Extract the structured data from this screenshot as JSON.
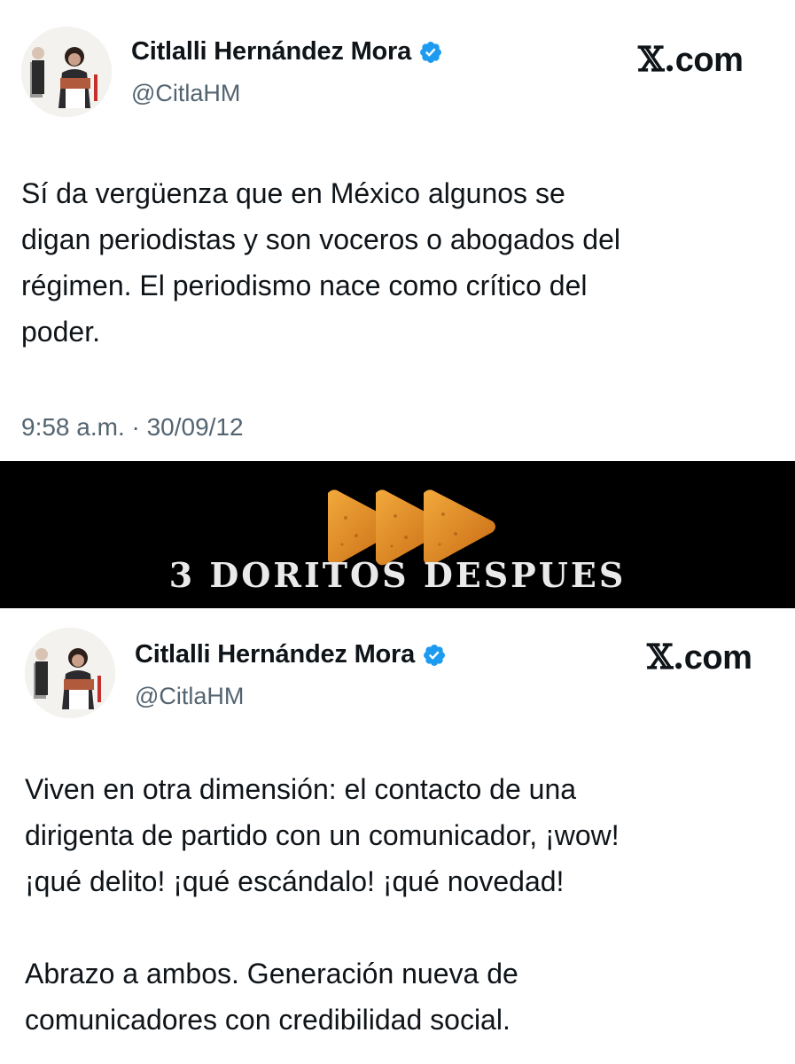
{
  "tweets": [
    {
      "display_name": "Citlalli Hernández Mora",
      "handle": "@CitlaHM",
      "site_label": "com",
      "site_logo": "𝕏.",
      "text": "Sí da vergüenza que en México algunos se\ndigan periodistas y son voceros o abogados del\nrégimen. El periodismo nace como crítico del\npoder.",
      "timestamp": "9:58 a.m. · 30/09/12",
      "verified_color": "#1d9bf0"
    },
    {
      "display_name": "Citlalli Hernández Mora",
      "handle": "@CitlaHM",
      "site_label": "com",
      "site_logo": "𝕏.",
      "text": "Viven en otra dimensión: el contacto de una\ndirigenta de partido con un comunicador, ¡wow!\n¡qué delito! ¡qué escándalo! ¡qué novedad!\n\nAbrazo a ambos. Generación nueva de\ncomunicadores con credibilidad social.",
      "verified_color": "#1d9bf0"
    }
  ],
  "separator": {
    "caption": "3 DORITOS DESPUES",
    "background": "#000000",
    "icon": "doritos-chips-icon"
  }
}
